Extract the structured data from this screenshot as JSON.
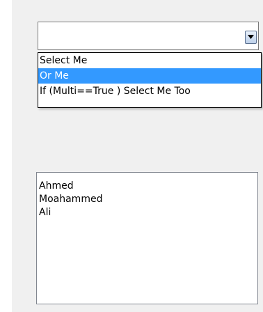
{
  "combobox": {
    "value": "",
    "arrow_icon": "chevron-down-icon",
    "options": [
      {
        "label": "Select Me",
        "selected": false
      },
      {
        "label": "Or Me",
        "selected": true
      },
      {
        "label": "If (Multi==True ) Select Me Too",
        "selected": false
      }
    ]
  },
  "listbox": {
    "items": [
      "Ahmed",
      "Moahammed",
      "Ali"
    ]
  },
  "colors": {
    "selection": "#3399ff",
    "background": "#f0f0f0"
  }
}
